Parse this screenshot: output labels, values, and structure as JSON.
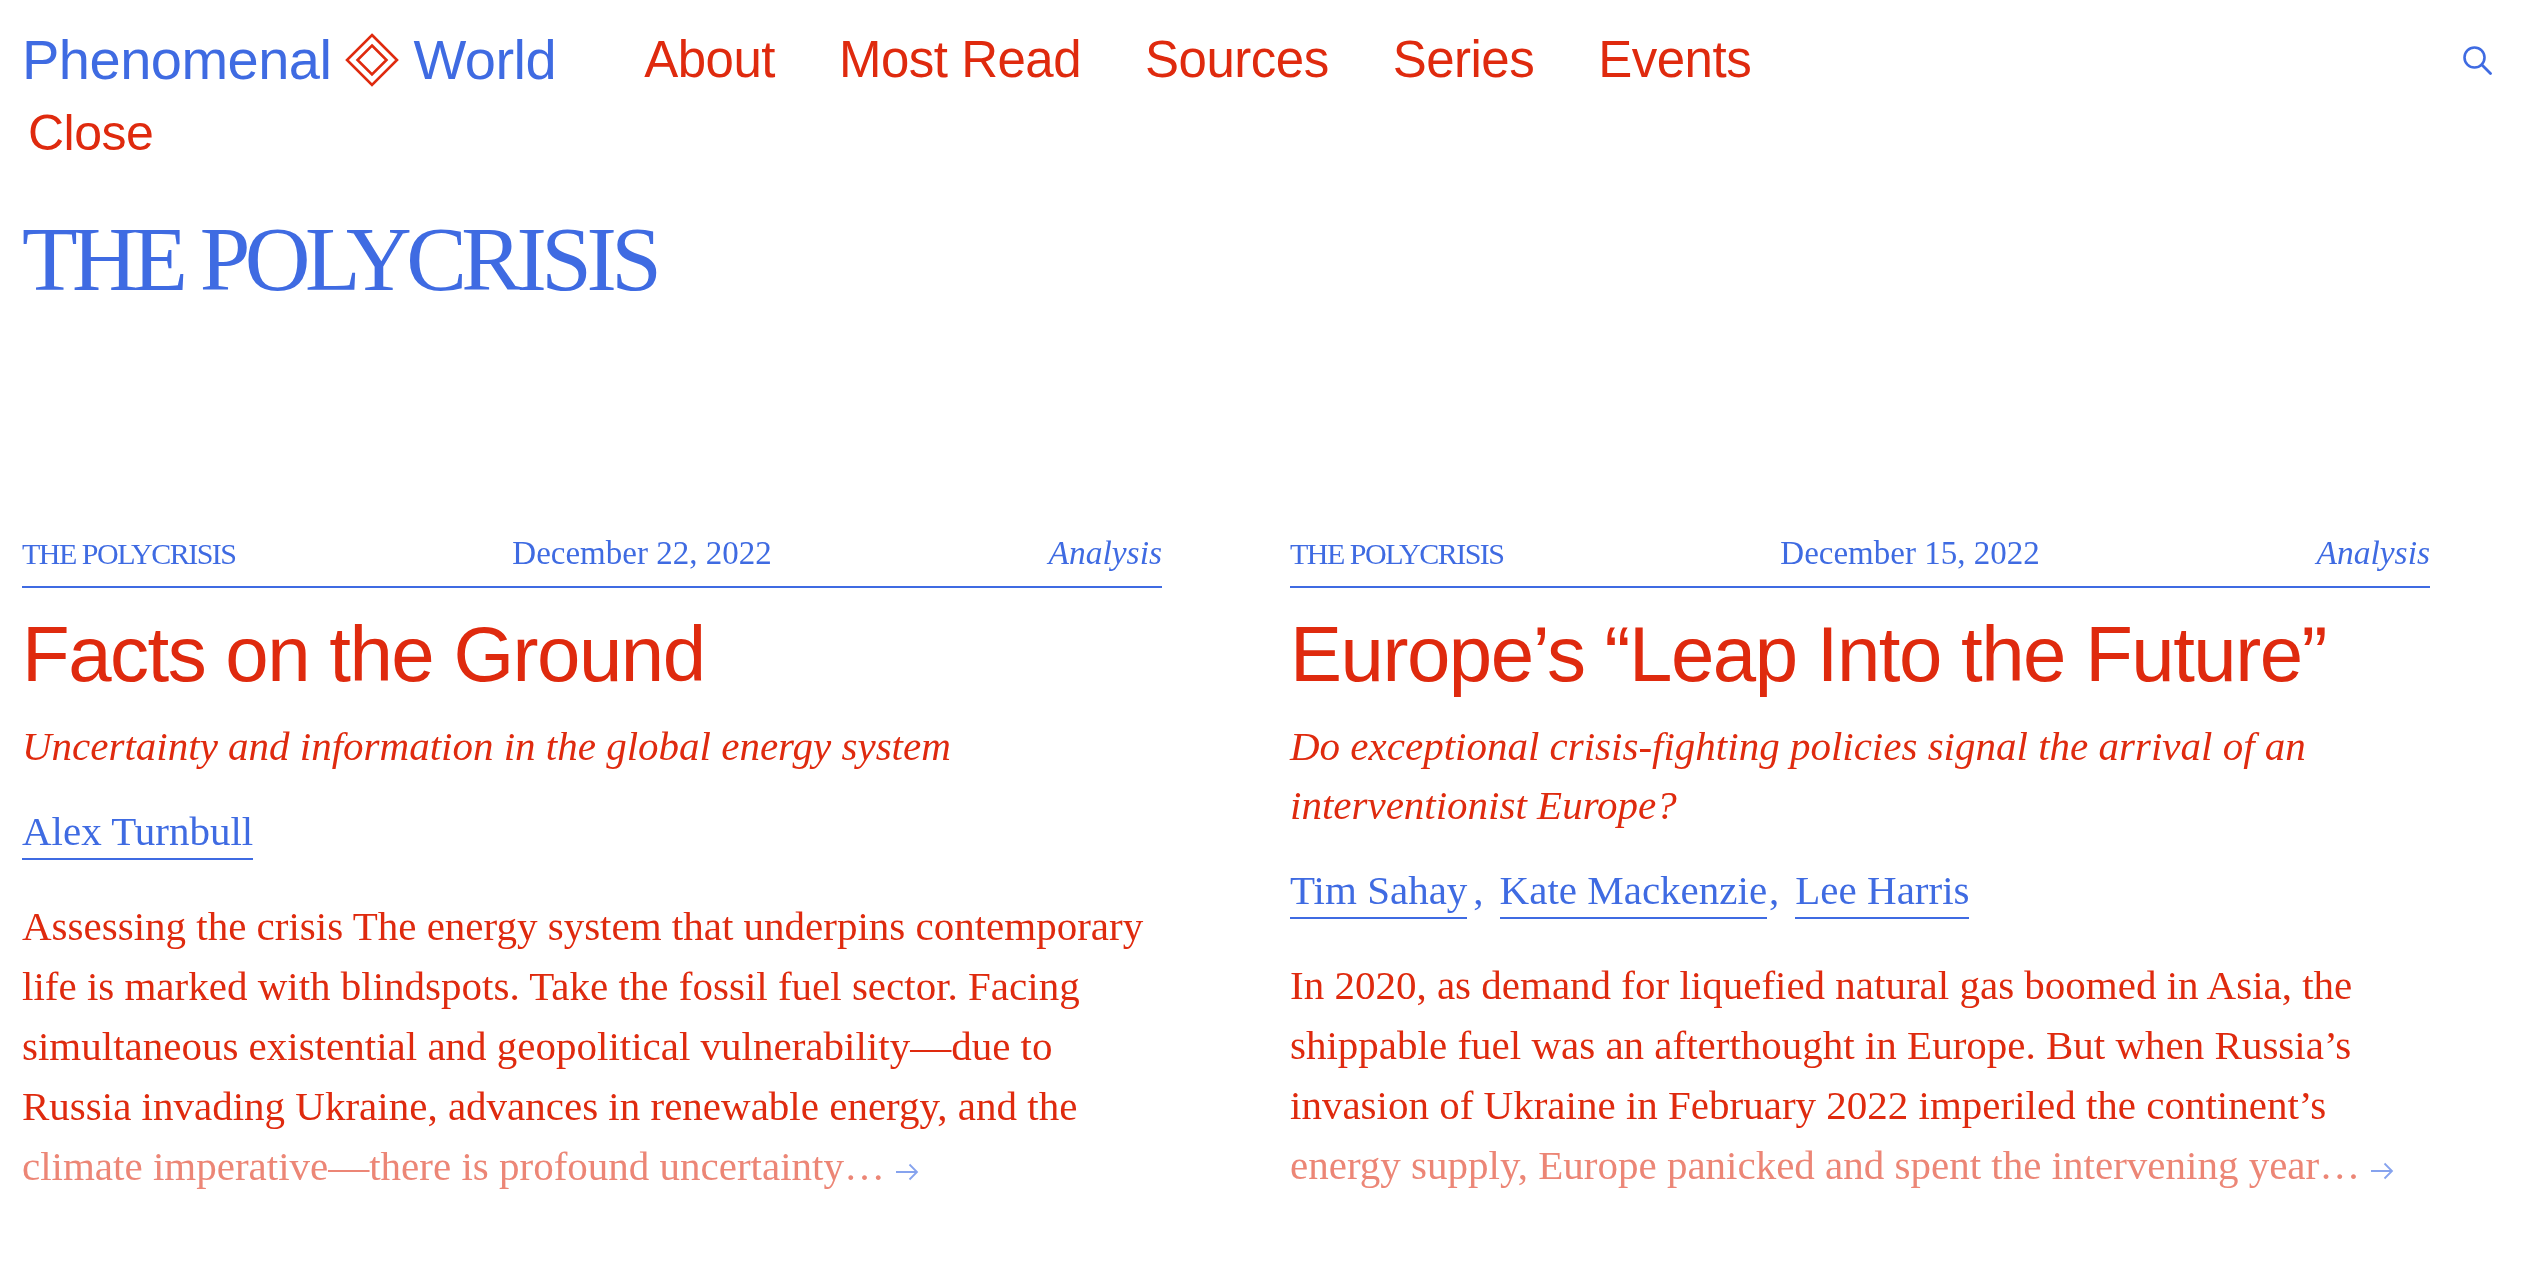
{
  "header": {
    "logo": {
      "text_left": "Phenomenal",
      "text_right": "World"
    },
    "nav": [
      {
        "label": "About"
      },
      {
        "label": "Most Read"
      },
      {
        "label": "Sources"
      },
      {
        "label": "Series"
      },
      {
        "label": "Events"
      }
    ],
    "close": "Close"
  },
  "series_title": "THE POLYCRISIS",
  "articles": [
    {
      "series": "THE POLYCRISIS",
      "date": "December 22, 2022",
      "category": "Analysis",
      "title": "Facts on the Ground",
      "subtitle": "Uncertainty and information in the global energy system",
      "authors": [
        {
          "name": "Alex Turnbull"
        }
      ],
      "excerpt": "Assessing the crisis The energy system that underpins contemporary life is marked with blindspots. Take the fossil fuel sector. Facing simultaneous existential and geopolitical vulnerability—due to Russia invading Ukraine, advances in renewable energy, and the",
      "excerpt_faded": "climate imperative—there is profound uncertainty…"
    },
    {
      "series": "THE POLYCRISIS",
      "date": "December 15, 2022",
      "category": "Analysis",
      "title": "Europe’s “Leap Into the Future”",
      "subtitle": "Do exceptional crisis-fighting policies signal the arrival of an interventionist Europe?",
      "authors": [
        {
          "name": "Tim Sahay",
          "after": ","
        },
        {
          "name": "Kate Mackenzie",
          "after": ","
        },
        {
          "name": "Lee Harris"
        }
      ],
      "excerpt": "In 2020, as demand for liquefied natural gas boomed in Asia, the shippable fuel was an afterthought in Europe. But when Russia’s invasion of Ukraine in February 2022 imperiled the continent’s",
      "excerpt_faded": "energy supply, Europe panicked and spent the intervening year…"
    }
  ]
}
